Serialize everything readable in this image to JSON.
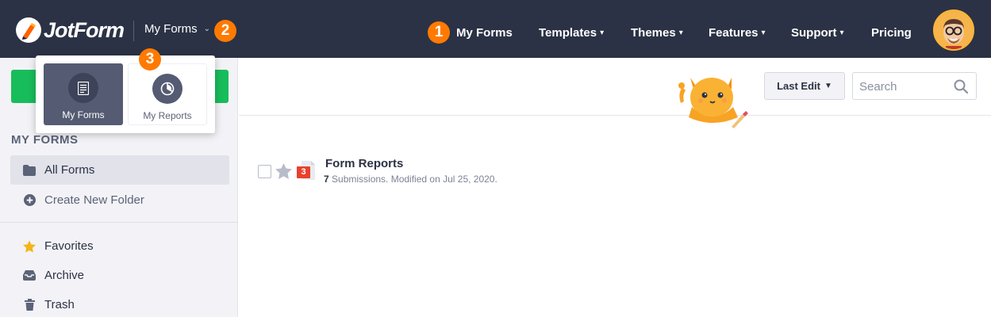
{
  "app": {
    "logo_text": "JotForm",
    "brand_color": "#2b3245",
    "accent_color": "#ff7a00",
    "create_color": "#18bd5b"
  },
  "header": {
    "switcher_label": "My Forms",
    "nav": [
      {
        "label": "My Forms",
        "caret": ""
      },
      {
        "label": "Templates",
        "caret": "▾"
      },
      {
        "label": "Themes",
        "caret": "▾"
      },
      {
        "label": "Features",
        "caret": "▾"
      },
      {
        "label": "Support",
        "caret": "▾"
      },
      {
        "label": "Pricing",
        "caret": ""
      }
    ]
  },
  "badges": {
    "one": "1",
    "two": "2",
    "three": "3"
  },
  "popover": {
    "items": [
      {
        "label": "My Forms",
        "icon": "form-icon",
        "active": true
      },
      {
        "label": "My Reports",
        "icon": "pie-chart-icon",
        "active": false
      }
    ]
  },
  "sidebar": {
    "section_title": "MY FORMS",
    "items": [
      {
        "label": "All Forms",
        "icon": "folder-icon"
      },
      {
        "label": "Create New Folder",
        "icon": "plus-circle-icon"
      },
      {
        "label": "Favorites",
        "icon": "star-icon"
      },
      {
        "label": "Archive",
        "icon": "inbox-icon"
      },
      {
        "label": "Trash",
        "icon": "trash-icon"
      }
    ]
  },
  "toolbar": {
    "sort_label": "Last Edit",
    "search_placeholder": "Search"
  },
  "forms": [
    {
      "title": "Form Reports",
      "submissions": "7",
      "meta_suffix": " Submissions. Modified on Jul 25, 2020.",
      "new_count": "3"
    }
  ]
}
